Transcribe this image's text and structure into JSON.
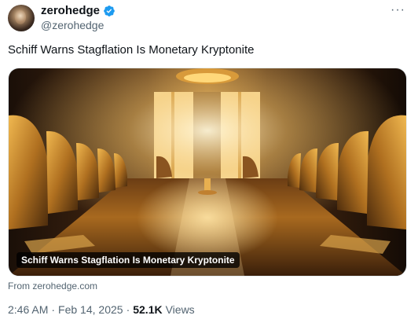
{
  "author": {
    "display_name": "zerohedge",
    "handle": "@zerohedge",
    "verified": true
  },
  "tweet": {
    "text": "Schiff Warns Stagflation Is Monetary Kryptonite"
  },
  "card": {
    "title_overlay": "Schiff Warns Stagflation Is Monetary Kryptonite",
    "source": "From zerohedge.com"
  },
  "meta": {
    "time": "2:46 AM",
    "separator": "·",
    "date": "Feb 14, 2025",
    "views_count": "52.1K",
    "views_label": "Views"
  },
  "icons": {
    "verified": "verified-badge-icon",
    "more": "more-options-icon"
  },
  "colors": {
    "verified_blue": "#1d9bf0",
    "secondary_text": "#536471",
    "primary_text": "#0f1419"
  }
}
